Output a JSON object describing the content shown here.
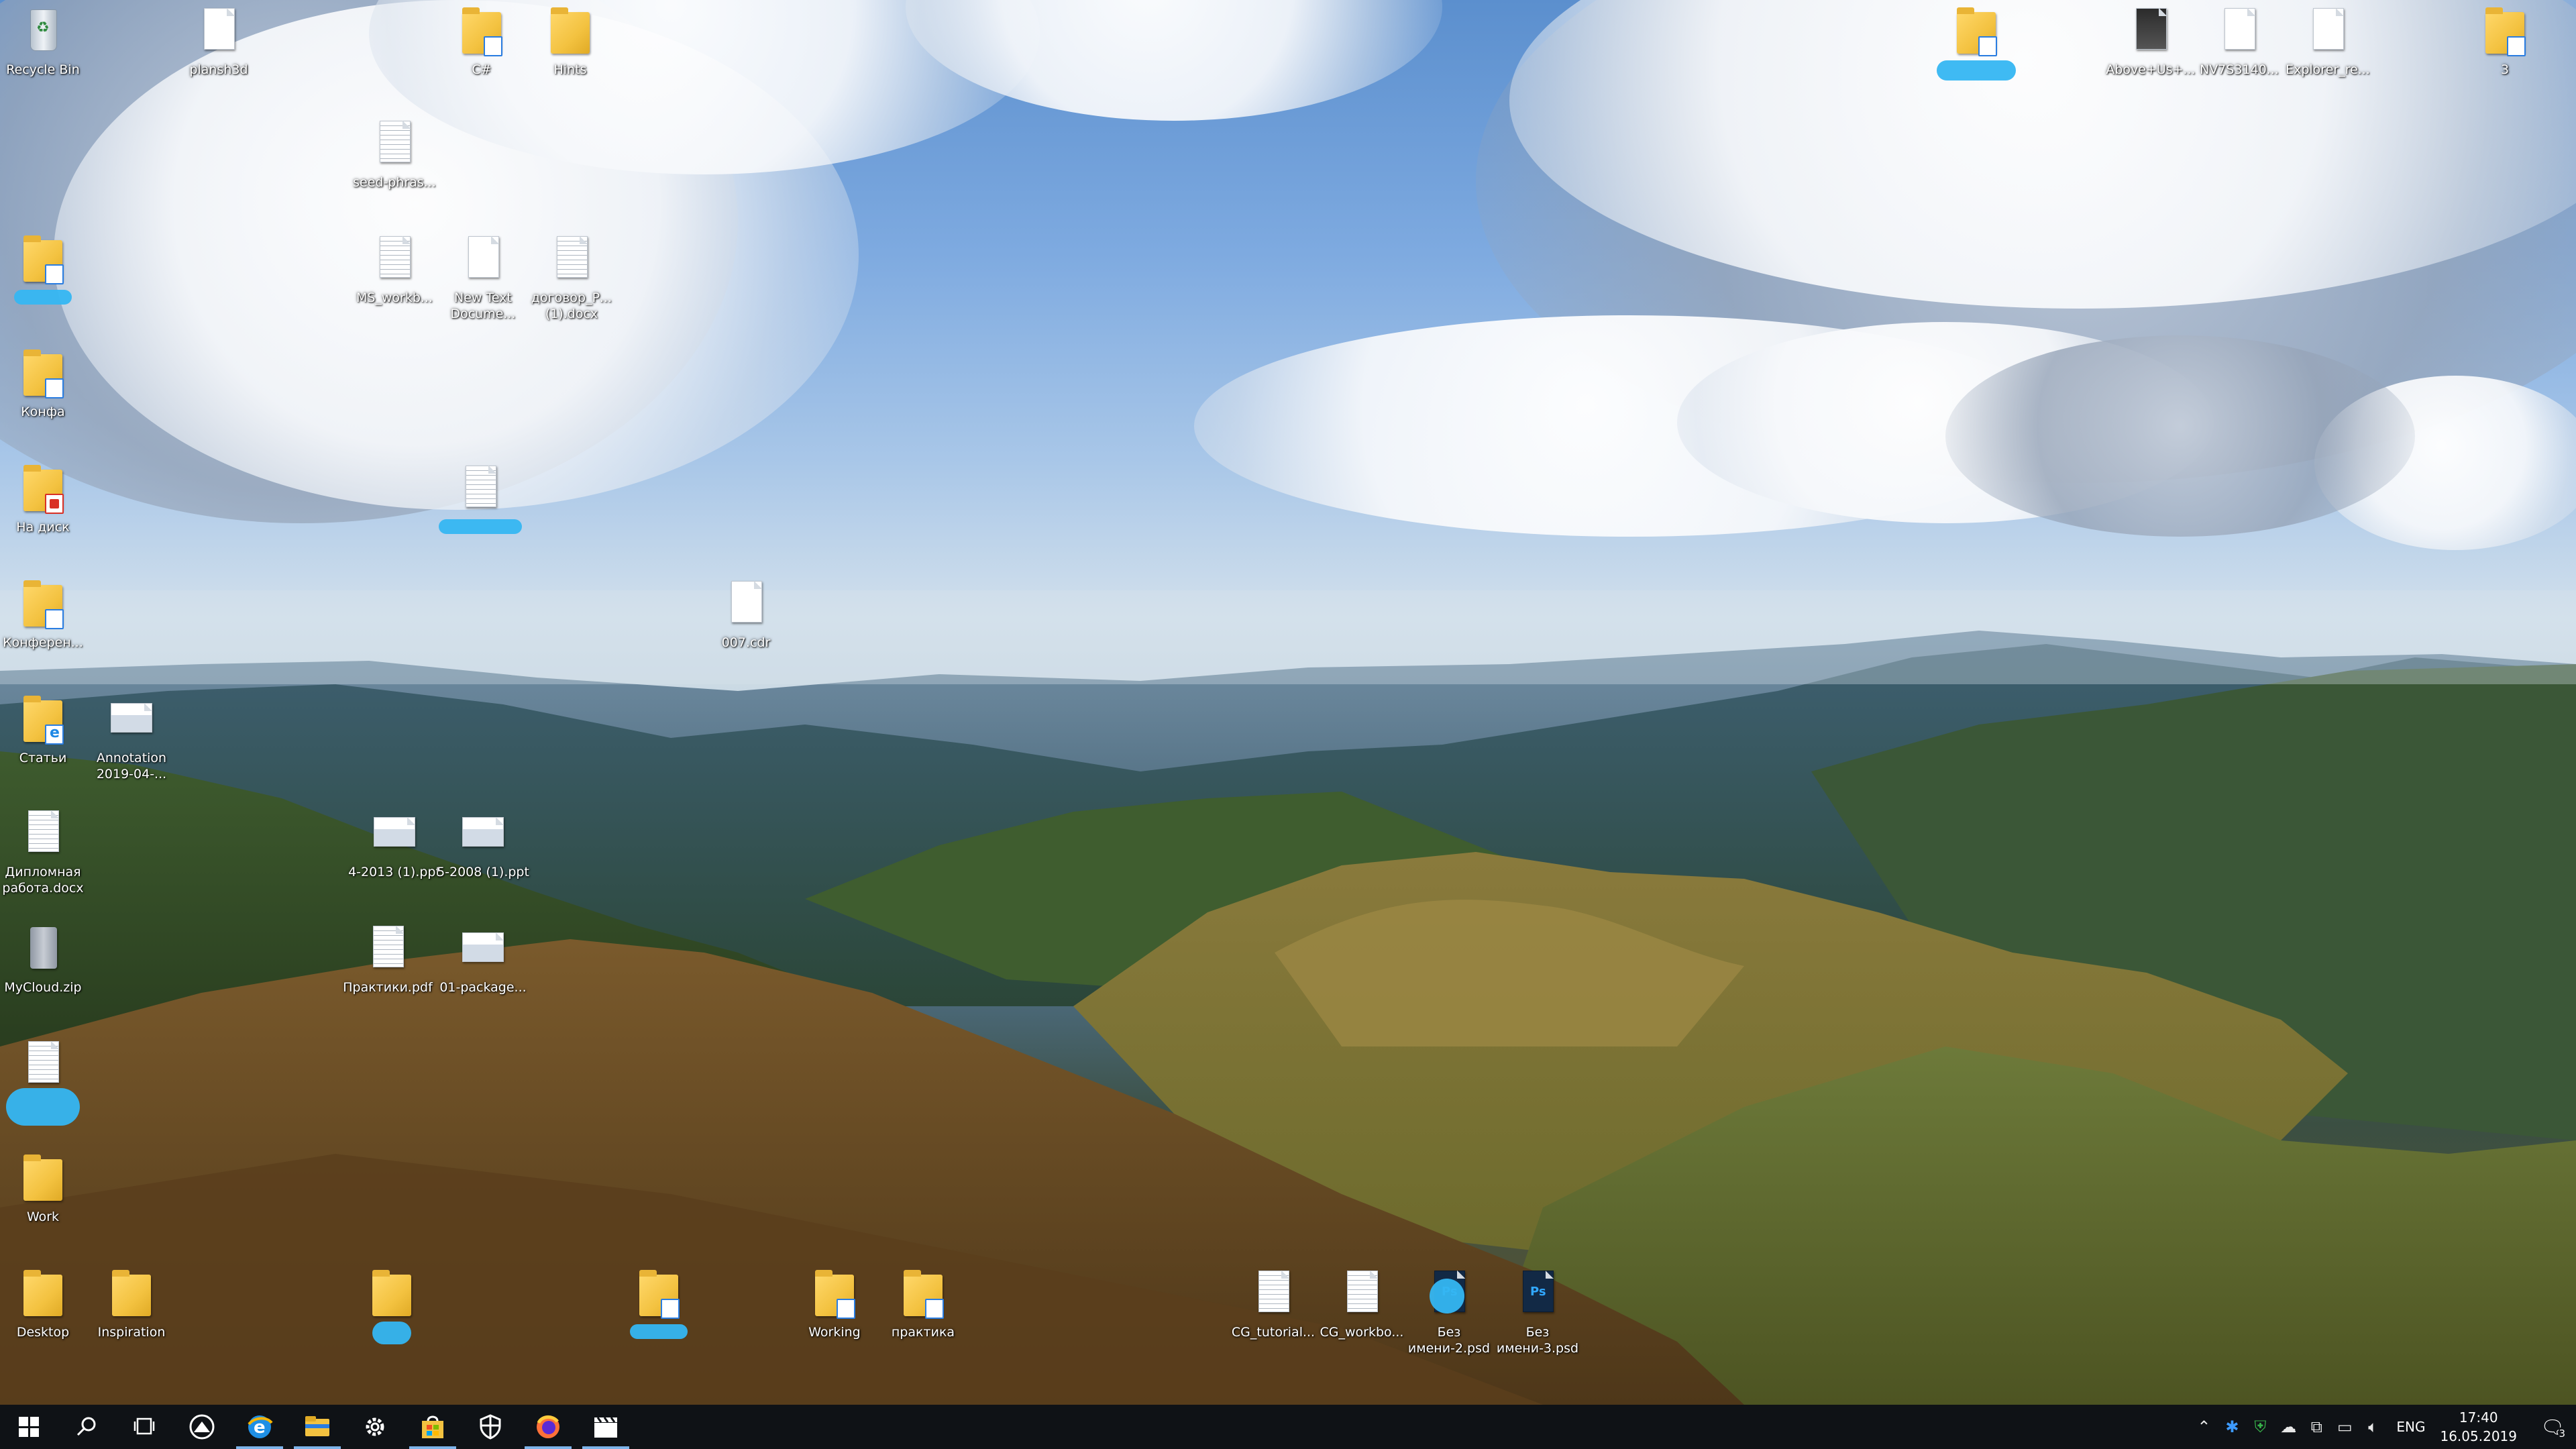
{
  "desktop": {
    "icons": {
      "recycle_bin": "Recycle Bin",
      "plansh": "plansh3d",
      "csharp": "C#",
      "hints": "Hints",
      "seed_phrase": "seed-phras...",
      "ms_workbook": "MS_workb...",
      "new_text_doc": "New Text Docume...",
      "dogovor": "договор_Р... (1).docx",
      "konfa": "Конфа",
      "na_disk": "На диск",
      "konferen": "Конферен...",
      "file_007": "007.cdr",
      "stati": "Статьи",
      "annotation": "Annotation 2019-04-...",
      "diplomnaya": "Дипломная работа.docx",
      "ppt_4_2013": "4-2013 (1).ppt",
      "ppt_5_2008": "5-2008 (1).ppt",
      "mycloud": "MyCloud.zip",
      "praktiki_pdf": "Практики.pdf",
      "package": "01-package...",
      "work": "Work",
      "desktop_folder": "Desktop",
      "inspiration": "Inspiration",
      "working": "Working",
      "praktika": "практика",
      "cg_tutorial": "CG_tutorial...",
      "cg_workbook": "CG_workbo...",
      "bez_imeni_2": "Без имени-2.psd",
      "bez_imeni_3": "Без имени-3.psd",
      "above_us": "Above+Us+...",
      "nv_file": "NV7S3140...",
      "explorer_re": "Explorer_re...",
      "folder_3": "3"
    }
  },
  "taskbar": {
    "start_icon": "windows-logo",
    "pinned": [
      "search-icon",
      "task-view-icon",
      "camera-app-icon",
      "edge-icon",
      "file-explorer-icon",
      "settings-icon",
      "store-icon",
      "defender-icon",
      "firefox-icon",
      "video-editor-icon"
    ],
    "language": "ENG",
    "time": "17:40",
    "date": "16.05.2019",
    "notification_count": "3"
  }
}
